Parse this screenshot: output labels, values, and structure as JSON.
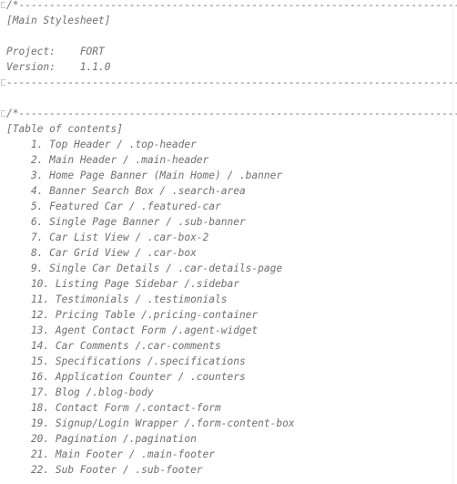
{
  "comment_header": {
    "open": "/*-----------------------------------------------------------------------------------",
    "title": "[Main Stylesheet]",
    "project": "Project:    FORT",
    "version": "Version:    1.1.0",
    "close": "-----------------------------------------------------------------------------------*/"
  },
  "toc": {
    "open": "/*-----------------------------------------------------------------------------------",
    "title": "[Table of contents]",
    "items": [
      "    1. Top Header / .top-header",
      "    2. Main Header / .main-header",
      "    3. Home Page Banner (Main Home) / .banner",
      "    4. Banner Search Box / .search-area",
      "    5. Featured Car / .featured-car",
      "    6. Single Page Banner / .sub-banner",
      "    7. Car List View / .car-box-2",
      "    8. Car Grid View / .car-box",
      "    9. Single Car Details / .car-details-page",
      "    10. Listing Page Sidebar /.sidebar",
      "    11. Testimonials / .testimonials",
      "    12. Pricing Table /.pricing-container",
      "    13. Agent Contact Form /.agent-widget",
      "    14. Car Comments /.car-comments",
      "    15. Specifications /.specifications",
      "    16. Application Counter / .counters",
      "    17. Blog /.blog-body",
      "    18. Contact Form /.contact-form",
      "    19. Signup/Login Wrapper /.form-content-box",
      "    20. Pagination /.pagination",
      "    21. Main Footer / .main-footer",
      "    22. Sub Footer / .sub-footer"
    ]
  }
}
